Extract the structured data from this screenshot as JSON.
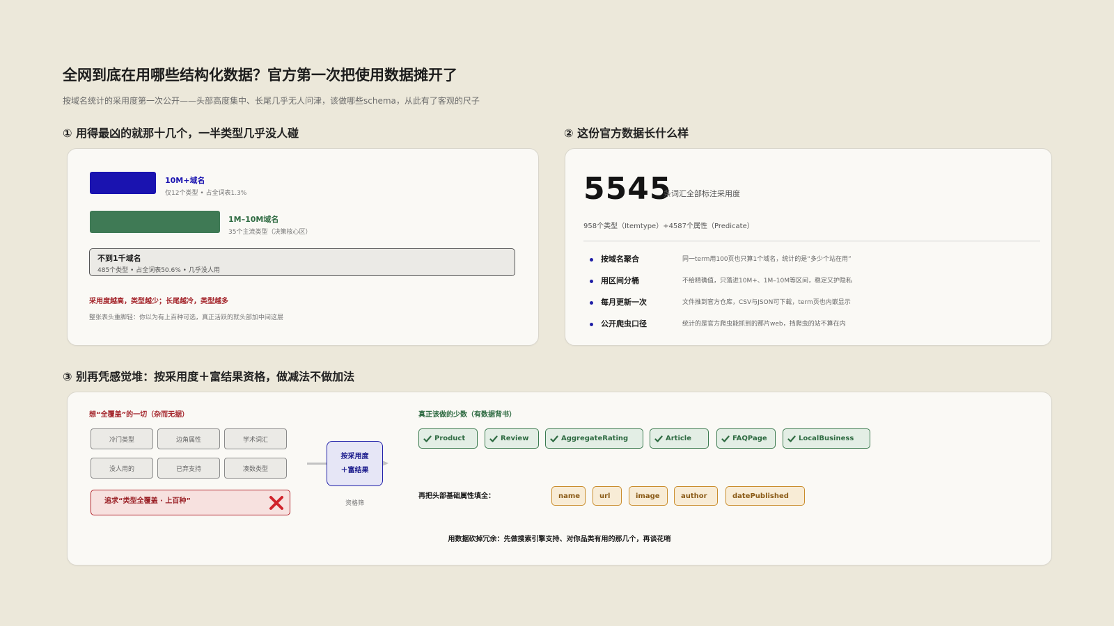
{
  "header": {
    "title": "全网到底在用哪些结构化数据？官方第一次把使用数据摊开了",
    "subtitle": "按域名统计的采用度第一次公开——头部高度集中、长尾几乎无人问津，该做哪些schema，从此有了客观的尺子"
  },
  "section1": {
    "heading": "① 用得最凶的就那十几个，一半类型几乎没人碰",
    "tiers": [
      {
        "title": "10M+域名",
        "desc": "仅12个类型 • 占全词表1.3%",
        "color": "#1a13b0"
      },
      {
        "title": "1M–10M域名",
        "desc": "35个主流类型（决策核心区）",
        "color": "#3f7a55"
      },
      {
        "title": "不到1千域名",
        "desc": "485个类型 • 占全词表50.6% • 几乎没人用",
        "color": "#ebeae6"
      }
    ],
    "conclusion": "采用度越高，类型越少；长尾越冷，类型越多",
    "note": "整张表头重脚轻：你以为有上百种可选，真正活跃的就头部加中间这层"
  },
  "section2": {
    "heading": "② 这份官方数据长什么样",
    "big_number": "5545",
    "big_label": "条词汇全部标注采用度",
    "breakdown": "958个类型（Itemtype）+4587个属性（Predicate）",
    "rows": [
      {
        "title": "按域名聚合",
        "desc": "同一term用100页也只算1个域名，统计的是“多少个站在用”"
      },
      {
        "title": "用区间分桶",
        "desc": "不给精确值，只落进10M+、1M–10M等区间，稳定又护隐私"
      },
      {
        "title": "每月更新一次",
        "desc": "文件推到官方仓库，CSV与JSON可下载，term页也内嵌显示"
      },
      {
        "title": "公开爬虫口径",
        "desc": "统计的是官方爬虫能抓到的那片web，挡爬虫的站不算在内"
      }
    ]
  },
  "section3": {
    "heading": "③ 别再凭感觉堆：按采用度＋富结果资格，做减法不做加法",
    "left_title": "想“全覆盖”的一切（杂而无据）",
    "bad_chips": [
      "冷门类型",
      "边角属性",
      "学术词汇",
      "没人用的",
      "已弃支持",
      "凑数类型"
    ],
    "bad_banner": "追求“类型全覆盖 · 上百种”",
    "filter_label": "按采用度\n＋富结果",
    "filter_caption": "资格筛",
    "right_title": "真正该做的少数（有数据背书）",
    "good_chips": [
      "Product",
      "Review",
      "AggregateRating",
      "Article",
      "FAQPage",
      "LocalBusiness"
    ],
    "props_label": "再把头部基础属性填全：",
    "props": [
      "name",
      "url",
      "image",
      "author",
      "datePublished"
    ],
    "footer": "用数据砍掉冗余：先做搜索引擎支持、对你品类有用的那几个，再谈花哨"
  },
  "colors": {
    "background": "#ece8da",
    "accent_blue": "#1a13b0",
    "accent_green": "#3f7a55",
    "warn_red": "#b3262e",
    "gold": "#c98c2a"
  }
}
